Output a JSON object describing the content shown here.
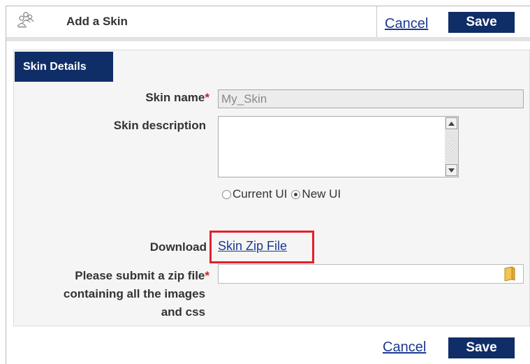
{
  "header": {
    "title": "Add a Skin",
    "icon": "people-icon",
    "cancel_label": "Cancel",
    "save_label": "Save"
  },
  "tab": {
    "label": "Skin Details"
  },
  "form": {
    "skin_name_label": "Skin name",
    "required_mark": "*",
    "skin_name_value": "My_Skin",
    "skin_description_label": "Skin description",
    "ui_options": [
      {
        "label": "Current UI",
        "selected": false
      },
      {
        "label": "New UI",
        "selected": true
      }
    ],
    "download_label": "Download",
    "download_link_text": "Skin Zip File",
    "zip_label_line1": "Please submit a zip file",
    "zip_label_line2": "containing all the images",
    "zip_label_line3": "and css"
  },
  "footer": {
    "cancel_label": "Cancel",
    "save_label": "Save"
  },
  "colors": {
    "accent": "#0f2d67",
    "link": "#1a3a8f",
    "required": "#d21e1e",
    "highlight": "#e3202a"
  }
}
